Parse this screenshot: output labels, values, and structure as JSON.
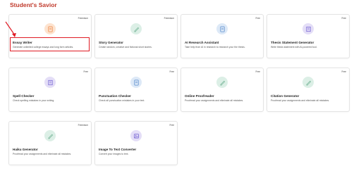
{
  "page": {
    "title": "Student's Savior"
  },
  "colors": {
    "title": "#c0392b",
    "highlight": "#e01b24",
    "orange_bg": "#fde3cf",
    "orange_fg": "#ef8a4b",
    "green_bg": "#dcefe6",
    "green_fg": "#79b79a",
    "blue_bg": "#dde9f7",
    "blue_fg": "#5d8fcf",
    "purple_bg": "#e4def7",
    "purple_fg": "#7c6cd6"
  },
  "cards": [
    {
      "badge": "Freemium",
      "title": "Essay Writer",
      "desc": "Generate unlimited college essays and long form articles.",
      "icon": "document-icon",
      "tone": "orange"
    },
    {
      "badge": "Freemium",
      "title": "Story Generator",
      "desc": "Create random, creative and fictional short stories.",
      "icon": "pen-icon",
      "tone": "green"
    },
    {
      "badge": "Free",
      "title": "AI Research Assistant",
      "desc": "Take help from AI in research to research your the thesis.",
      "icon": "document-icon",
      "tone": "blue"
    },
    {
      "badge": "Free",
      "title": "Thesis Statement Generator",
      "desc": "Write thesis statement with AI-powered tool.",
      "icon": "book-icon",
      "tone": "purple"
    },
    {
      "badge": "Free",
      "title": "Spell Checker",
      "desc": "Check spelling mistakes in your writing.",
      "icon": "book-icon",
      "tone": "purple"
    },
    {
      "badge": "Free",
      "title": "Punctuation Checker",
      "desc": "Check all punctuation mistakes in your text.",
      "icon": "document-icon",
      "tone": "blue"
    },
    {
      "badge": "Free",
      "title": "Online Proofreader",
      "desc": "Proofread your assignments and eliminate all mistakes.",
      "icon": "pen-icon",
      "tone": "green"
    },
    {
      "badge": "Free",
      "title": "Citation Generator",
      "desc": "Proofread your assignments and eliminate all mistakes.",
      "icon": "pen-icon",
      "tone": "green"
    },
    {
      "badge": "Freemium",
      "title": "Haiku Generator",
      "desc": "Proofread your assignments and eliminate all mistakes.",
      "icon": "pen-icon",
      "tone": "green"
    },
    {
      "badge": "Free",
      "title": "Image To Text Converter",
      "desc": "Convert your images to text.",
      "icon": "image-icon",
      "tone": "purple"
    }
  ]
}
